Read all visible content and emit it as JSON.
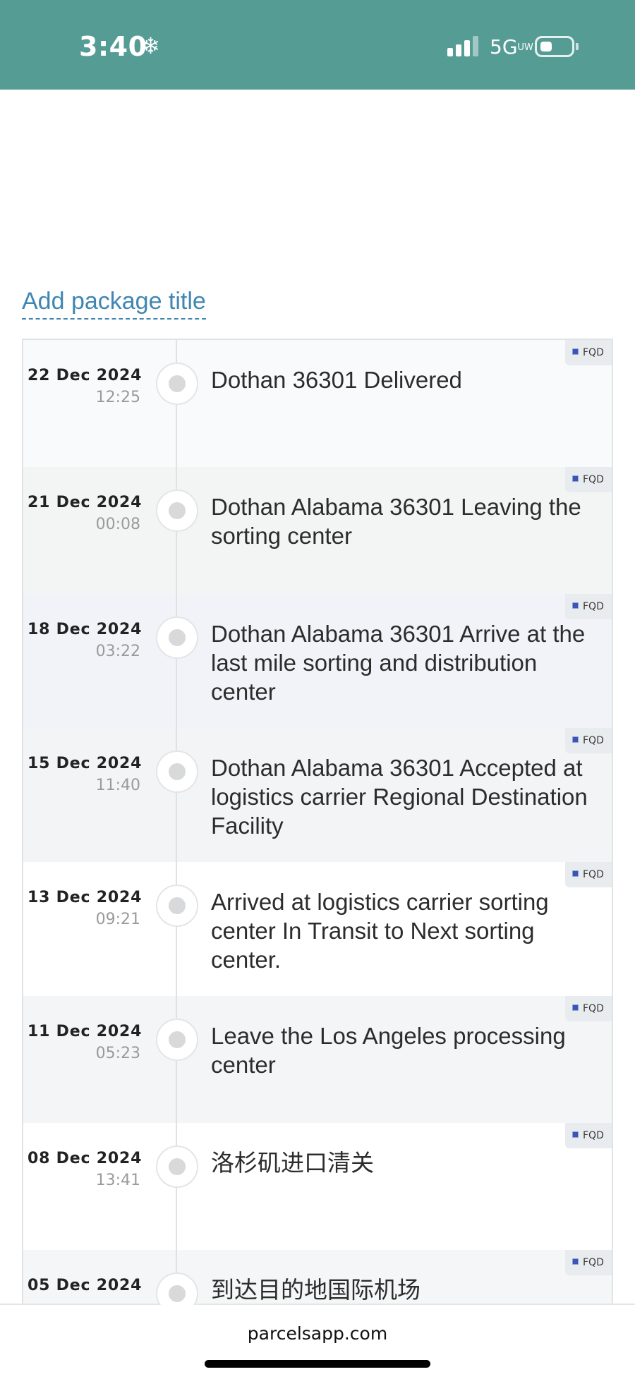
{
  "status_bar": {
    "time": "3:40",
    "weather_icon": "snowflake-icon",
    "network": "5G",
    "network_suffix": "UW",
    "bar_color": "#559c95"
  },
  "package": {
    "add_title_label": "Add package title"
  },
  "events": [
    {
      "date": "22 Dec 2024",
      "time": "12:25",
      "text": "Dothan 36301 Delivered",
      "source": "FQD"
    },
    {
      "date": "21 Dec 2024",
      "time": "00:08",
      "text": "Dothan Alabama 36301 Leaving the sorting center",
      "source": "FQD"
    },
    {
      "date": "18 Dec 2024",
      "time": "03:22",
      "text": "Dothan Alabama 36301 Arrive at the last mile sorting and distribution center",
      "source": "FQD"
    },
    {
      "date": "15 Dec 2024",
      "time": "11:40",
      "text": "Dothan Alabama 36301 Accepted at logistics carrier Regional Destination Facility",
      "source": "FQD"
    },
    {
      "date": "13 Dec 2024",
      "time": "09:21",
      "text": "Arrived at logistics carrier sorting center In Transit to Next sorting center.",
      "source": "FQD"
    },
    {
      "date": "11 Dec 2024",
      "time": "05:23",
      "text": "Leave the Los Angeles processing center",
      "source": "FQD"
    },
    {
      "date": "08 Dec 2024",
      "time": "13:41",
      "text": "洛杉矶进口清关",
      "source": "FQD"
    },
    {
      "date": "05 Dec 2024",
      "time": "",
      "text": "到达目的地国际机场",
      "source": "FQD"
    }
  ],
  "footer": {
    "domain": "parcelsapp.com"
  }
}
